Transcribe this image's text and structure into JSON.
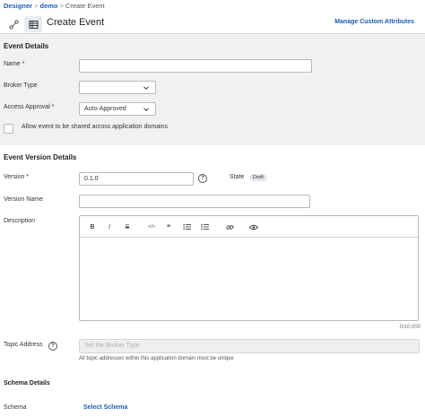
{
  "breadcrumb": {
    "root": "Designer",
    "parent": "demo",
    "current": "Create Event",
    "separator": ">"
  },
  "header": {
    "title": "Create Event",
    "manage_link": "Manage Custom Attributes"
  },
  "event_details": {
    "title": "Event Details",
    "name_label": "Name *",
    "name_value": "",
    "broker_type_label": "Broker Type",
    "broker_type_value": "",
    "access_approval_label": "Access Approval *",
    "access_approval_value": "Auto-Approved",
    "share_label": "Allow event to be shared across application domains",
    "share_checked": false
  },
  "version_details": {
    "title": "Event Version Details",
    "version_label": "Version *",
    "version_value": "0.1.0",
    "help_glyph": "?",
    "state_label": "State",
    "state_value": "Draft",
    "version_name_label": "Version Name",
    "version_name_value": "",
    "description_label": "Description",
    "description_value": "",
    "char_count": "0/10,000",
    "toolbar": {
      "bold": "B",
      "italic": "I",
      "strike": "S",
      "code": "</>",
      "quote": "❝",
      "bullets": "bullet-list-icon",
      "numbers": "numbered-list-icon",
      "link": "link-icon",
      "preview": "eye-icon"
    },
    "topic_label": "Topic Address",
    "topic_placeholder": "Set the Broker Type",
    "topic_hint": "All topic addresses within this application domain must be unique"
  },
  "schema_details": {
    "title": "Schema Details",
    "schema_label": "Schema",
    "select_schema": "Select Schema"
  },
  "colors": {
    "link": "#1a5fb4",
    "panel_bg": "#f1f1f2",
    "border": "#b8b8b8"
  }
}
